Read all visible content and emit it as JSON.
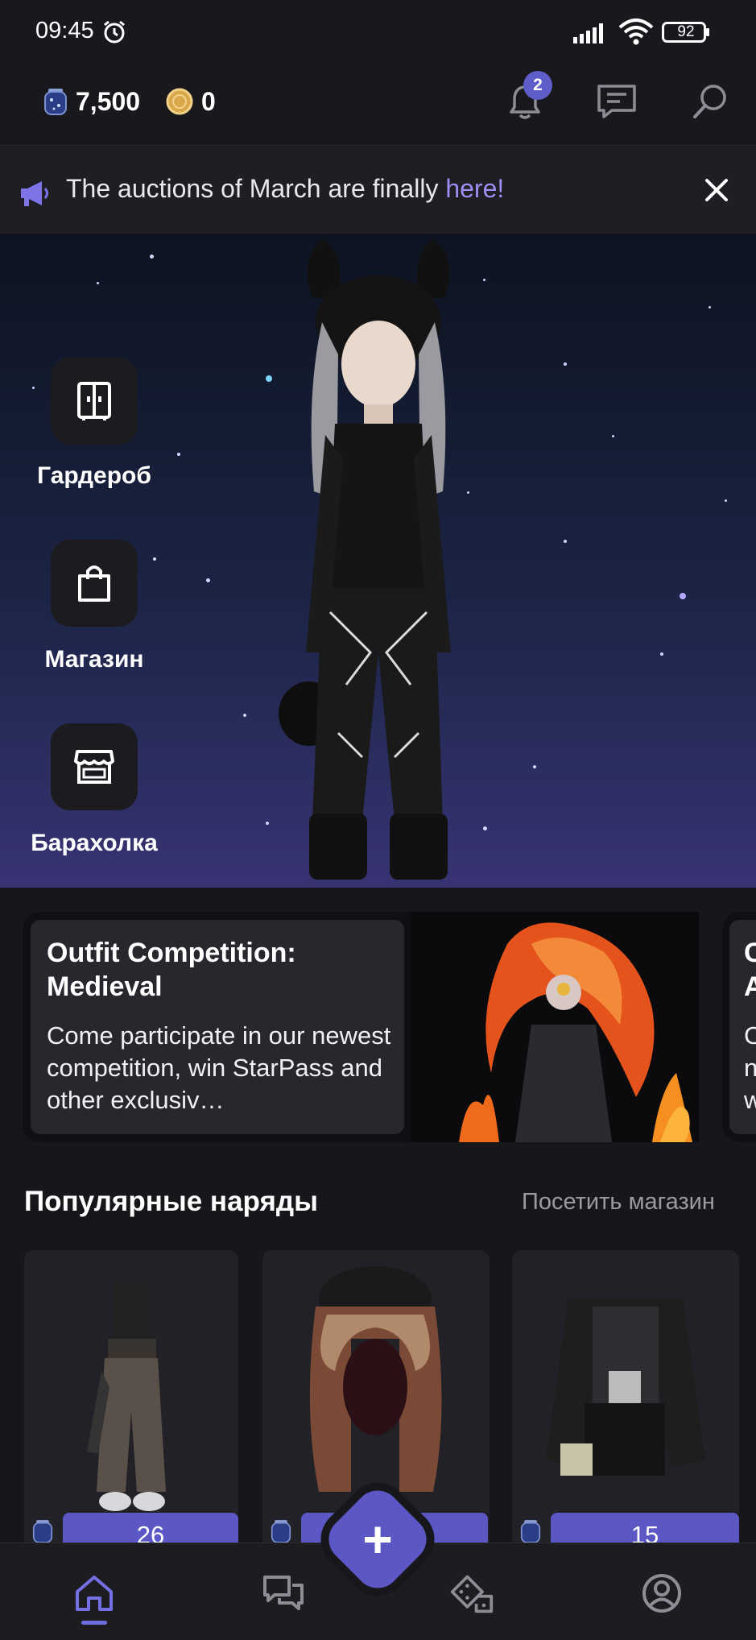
{
  "status_bar": {
    "time": "09:45",
    "battery": "92"
  },
  "top_bar": {
    "stars_balance": "7,500",
    "coins_balance": "0",
    "notification_count": "2",
    "icons": [
      "bell-icon",
      "chat-icon",
      "search-icon"
    ]
  },
  "announcement": {
    "text": "The auctions of March are finally ",
    "link": "here!"
  },
  "hero": {
    "buttons": [
      {
        "label": "Гардероб",
        "icon": "wardrobe-icon"
      },
      {
        "label": "Магазин",
        "icon": "shopping-bag-icon"
      },
      {
        "label": "Барахолка",
        "icon": "storefront-icon"
      }
    ]
  },
  "promo": {
    "title": "Outfit Competition: Medieval",
    "description": "Come participate in our newest competition, win StarPass and other exclusiv…",
    "next_title_fragment": "C\nA",
    "next_desc_fragment": "C\nn\nw"
  },
  "popular": {
    "title": "Популярные наряды",
    "visit_link": "Посетить магазин",
    "items": [
      {
        "price": "26"
      },
      {
        "price": ""
      },
      {
        "price": "15"
      }
    ]
  },
  "bottom_nav": {
    "items": [
      "home-icon",
      "chats-icon",
      "games-icon",
      "profile-icon"
    ],
    "fab": "+"
  },
  "colors": {
    "accent": "#5b58c6",
    "link": "#9d8ff2",
    "background": "#17171b"
  }
}
